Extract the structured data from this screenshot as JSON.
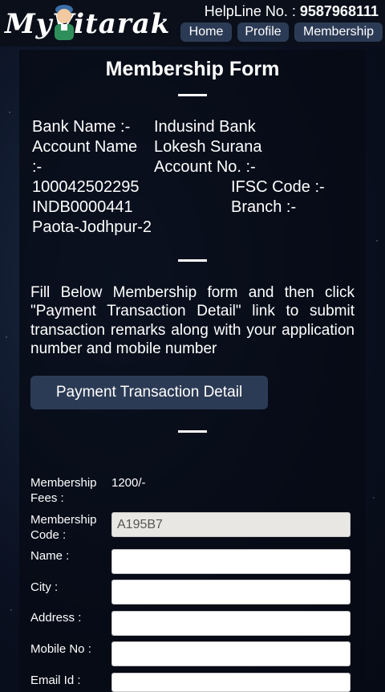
{
  "header": {
    "logo_text": "MyVitarak",
    "helpline_label": "HelpLine No. :",
    "helpline_number": "9587968111",
    "nav": [
      {
        "label": "Home"
      },
      {
        "label": "Profile"
      },
      {
        "label": "Membership"
      }
    ]
  },
  "form": {
    "title": "Membership Form",
    "bank": {
      "bank_name_label": "Bank Name :-",
      "bank_name_value": "Indusind Bank",
      "account_name_label": "Account Name",
      "account_name_value": "Lokesh Surana",
      "colon_dash": ":-",
      "account_no_label": "Account No. :-",
      "account_no_value": "100042502295",
      "ifsc_label": "IFSC Code :-",
      "ifsc_value": "INDB0000441",
      "branch_label": "Branch :-",
      "branch_value": "Paota-Jodhpur-2"
    },
    "instructions": "Fill Below Membership form and then click \"Payment Transaction Detail\" link to submit transaction remarks along with your application number and mobile number",
    "payment_button": "Payment Transaction Detail",
    "fields": {
      "fees_label_1": "Membership",
      "fees_label_2": "Fees :",
      "fees_value": "1200/-",
      "code_label_1": "Membership",
      "code_label_2": "Code :",
      "code_value": "A195B7",
      "name_label": "Name :",
      "name_value": "",
      "city_label": "City :",
      "city_value": "",
      "address_label": "Address :",
      "address_value": "",
      "mobile_label": "Mobile No :",
      "mobile_value": "",
      "email_label": "Email Id :",
      "email_value": ""
    }
  }
}
